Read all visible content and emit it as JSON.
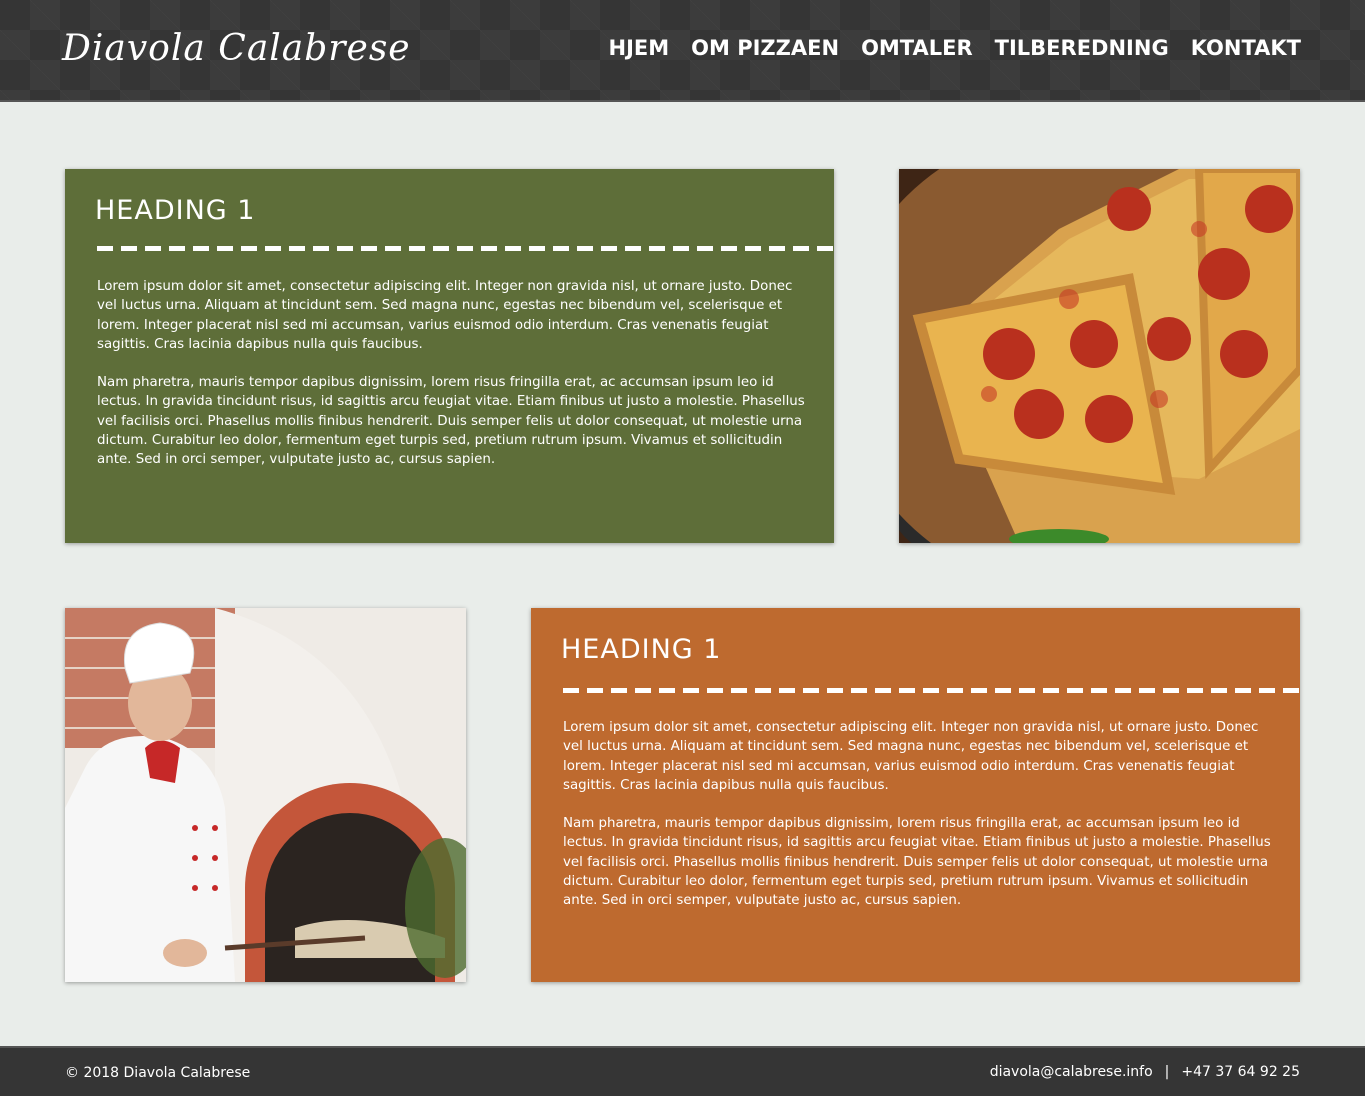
{
  "header": {
    "logo": "Diavola Calabrese",
    "nav": [
      "HJEM",
      "OM PIZZAEN",
      "OMTALER",
      "TILBEREDNING",
      "KONTAKT"
    ]
  },
  "section1": {
    "heading": "HEADING 1",
    "paragraphs": [
      "Lorem ipsum dolor sit amet, consectetur adipiscing elit. Integer non gravida nisl, ut ornare justo. Donec vel luctus urna. Aliquam at tincidunt sem. Sed magna nunc, egestas nec bibendum vel, scelerisque et lorem. Integer placerat nisl sed mi accumsan, varius euismod odio interdum. Cras venenatis feugiat sagittis. Cras lacinia dapibus nulla quis faucibus.",
      "Nam pharetra, mauris tempor dapibus dignissim, lorem risus fringilla erat, ac accumsan ipsum leo id lectus. In gravida tincidunt risus, id sagittis arcu feugiat vitae. Etiam finibus ut justo a molestie. Phasellus vel facilisis orci. Phasellus mollis finibus hendrerit. Duis semper felis ut dolor consequat, ut molestie urna dictum. Curabitur leo dolor, fermentum eget turpis sed, pretium rutrum ipsum. Vivamus et sollicitudin ante. Sed in orci semper, vulputate justo ac, cursus sapien."
    ]
  },
  "section2": {
    "heading": "HEADING 1",
    "paragraphs": [
      "Lorem ipsum dolor sit amet, consectetur adipiscing elit. Integer non gravida nisl, ut ornare justo. Donec vel luctus urna. Aliquam at tincidunt sem. Sed magna nunc, egestas nec bibendum vel, scelerisque et lorem. Integer placerat nisl sed mi accumsan, varius euismod odio interdum. Cras venenatis feugiat sagittis. Cras lacinia dapibus nulla quis faucibus.",
      "Nam pharetra, mauris tempor dapibus dignissim, lorem risus fringilla erat, ac accumsan ipsum leo id lectus. In gravida tincidunt risus, id sagittis arcu feugiat vitae. Etiam finibus ut justo a molestie. Phasellus vel facilisis orci. Phasellus mollis finibus hendrerit. Duis semper felis ut dolor consequat, ut molestie urna dictum. Curabitur leo dolor, fermentum eget turpis sed, pretium rutrum ipsum. Vivamus et sollicitudin ante. Sed in orci semper, vulputate justo ac, cursus sapien."
    ]
  },
  "footer": {
    "copyright": "© 2018 Diavola Calabrese",
    "email": "diavola@calabrese.info",
    "separator": "|",
    "phone": "+47 37 64 92 25"
  },
  "colors": {
    "header_bg": "#353535",
    "page_bg": "#e9edea",
    "green_card": "#5e6e39",
    "orange_card": "#be6a2f"
  },
  "images": {
    "pizza": "pepperoni-pizza-photo",
    "chef": "chef-at-pizza-oven-photo"
  }
}
